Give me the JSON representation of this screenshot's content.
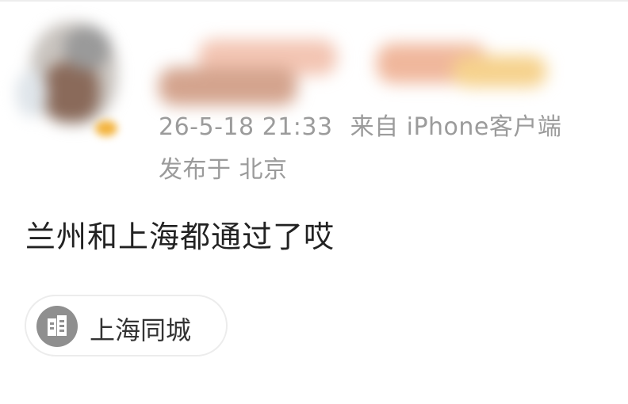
{
  "post": {
    "meta_time_date": "26-5-18 21:33",
    "meta_source": "来自 iPhone客户端",
    "meta_location": "发布于 北京",
    "content": "兰州和上海都通过了哎",
    "tag": {
      "label": "上海同城",
      "icon": "building-icon"
    }
  },
  "colors": {
    "meta_text": "#9b9b9b",
    "content_text": "#222222",
    "tag_icon_bg": "#8f8f8f"
  }
}
